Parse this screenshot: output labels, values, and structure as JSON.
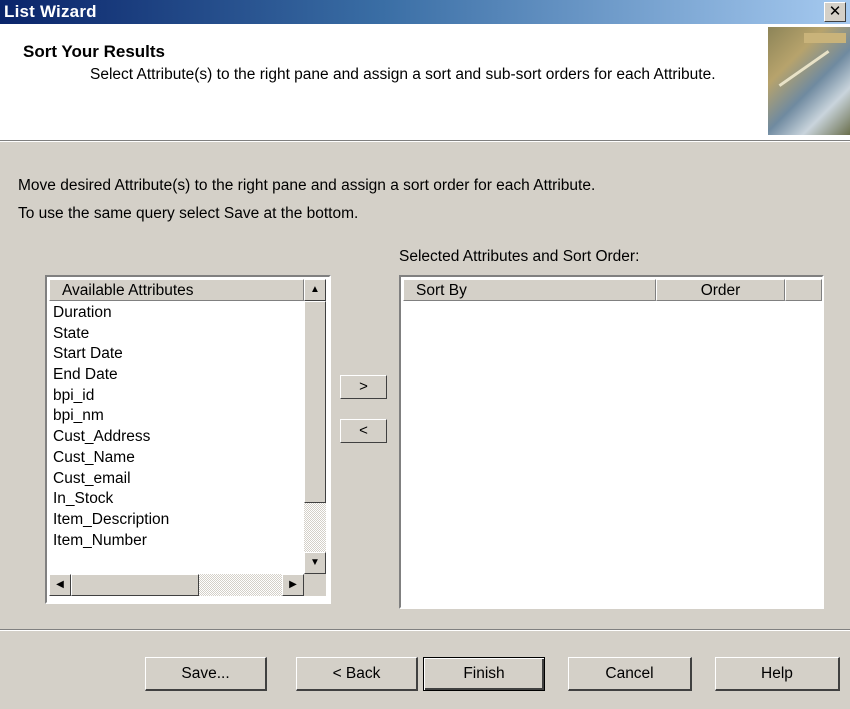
{
  "window": {
    "title": "List Wizard",
    "close_glyph": "✕"
  },
  "header": {
    "title": "Sort Your Results",
    "description": "Select Attribute(s) to the right pane and assign a sort and sub-sort orders for each Attribute."
  },
  "instructions": {
    "line1": "Move desired Attribute(s) to the right pane and assign a sort order for each Attribute.",
    "line2": "To use the same query select Save at the bottom."
  },
  "available": {
    "header": "Available Attributes",
    "items": [
      "Duration",
      "State",
      "Start Date",
      "End Date",
      "bpi_id",
      "bpi_nm",
      "Cust_Address",
      "Cust_Name",
      "Cust_email",
      "In_Stock",
      "Item_Description",
      "Item_Number"
    ]
  },
  "move": {
    "add_label": ">",
    "remove_label": "<"
  },
  "selected": {
    "label": "Selected Attributes and Sort Order:",
    "col_sort_by": "Sort By",
    "col_order": "Order"
  },
  "buttons": {
    "save": "Save...",
    "back": "< Back",
    "finish": "Finish",
    "cancel": "Cancel",
    "help": "Help"
  },
  "scroll_glyphs": {
    "up": "▲",
    "down": "▼",
    "left": "◀",
    "right": "▶"
  }
}
